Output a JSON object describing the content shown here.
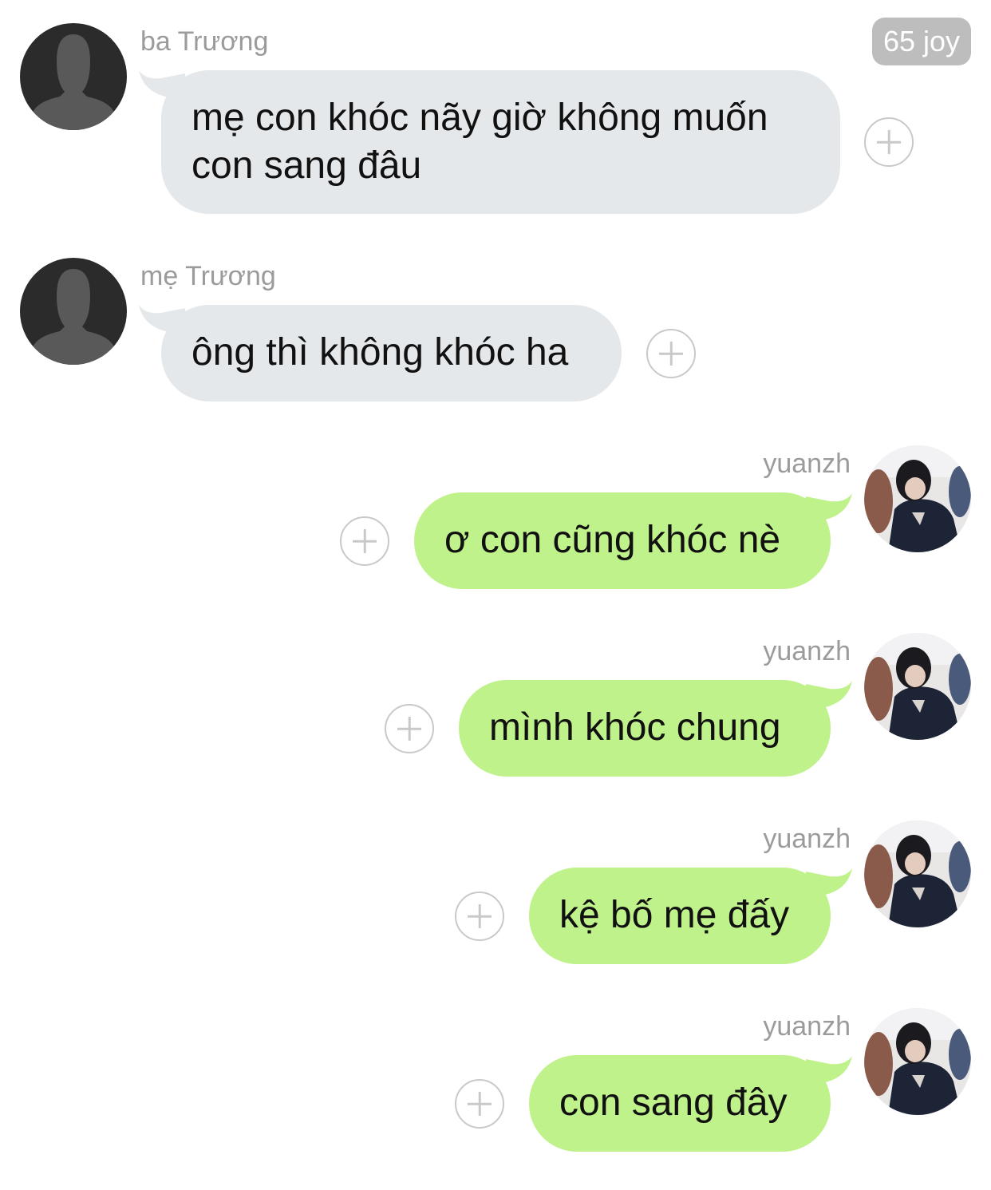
{
  "badge": {
    "label": "65 joy"
  },
  "messages": [
    {
      "sender": "ba Trương",
      "text": "mẹ con khóc nãy giờ không muốn con sang đâu",
      "direction": "incoming",
      "avatar": "default-user-avatar"
    },
    {
      "sender": "mẹ Trương",
      "text": "ông thì không khóc ha",
      "direction": "incoming",
      "avatar": "default-user-avatar"
    },
    {
      "sender": "yuanzh",
      "text": "ơ con cũng khóc nè",
      "direction": "outgoing",
      "avatar": "user-photo-avatar"
    },
    {
      "sender": "yuanzh",
      "text": "mình khóc chung",
      "direction": "outgoing",
      "avatar": "user-photo-avatar"
    },
    {
      "sender": "yuanzh",
      "text": "kệ bố mẹ đấy",
      "direction": "outgoing",
      "avatar": "user-photo-avatar"
    },
    {
      "sender": "yuanzh",
      "text": "con sang đây",
      "direction": "outgoing",
      "avatar": "user-photo-avatar"
    }
  ],
  "colors": {
    "incoming_bubble": "#e5e8ea",
    "outgoing_bubble": "#c0f28c",
    "sender_name": "#9b9b9b",
    "badge_bg": "#bdbdbd",
    "add_icon": "#c9c9c9"
  },
  "icons": {
    "add_reaction": "plus-circle-icon"
  }
}
